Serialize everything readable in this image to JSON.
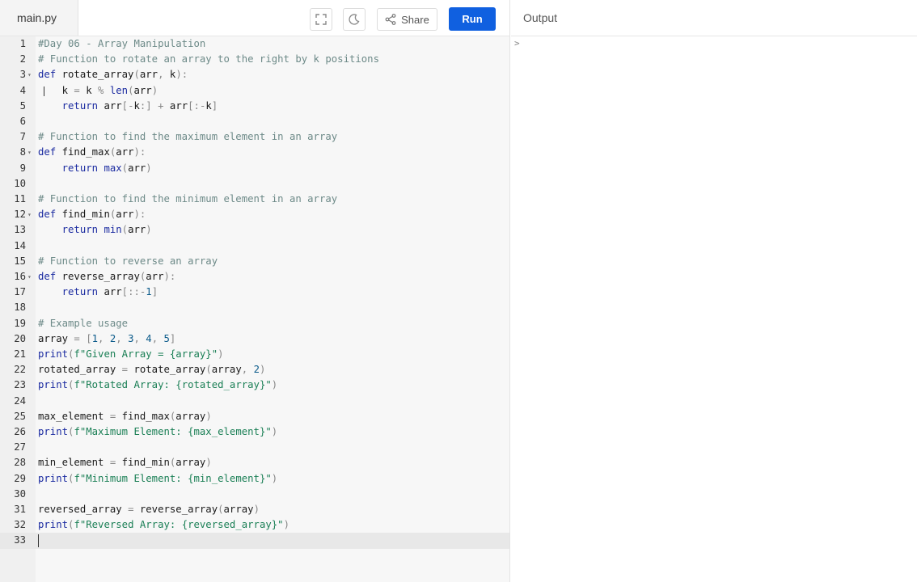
{
  "editor": {
    "file_tab": "main.py",
    "share_label": "Share",
    "run_label": "Run",
    "code_lines": [
      "#Day 06 - Array Manipulation",
      "# Function to rotate an array to the right by k positions",
      "def rotate_array(arr, k):",
      "    k = k % len(arr)",
      "    return arr[-k:] + arr[:-k]",
      "",
      "# Function to find the maximum element in an array",
      "def find_max(arr):",
      "    return max(arr)",
      "",
      "# Function to find the minimum element in an array",
      "def find_min(arr):",
      "    return min(arr)",
      "",
      "# Function to reverse an array",
      "def reverse_array(arr):",
      "    return arr[::-1]",
      "",
      "# Example usage",
      "array = [1, 2, 3, 4, 5]",
      "print(f\"Given Array = {array}\")",
      "rotated_array = rotate_array(array, 2)",
      "print(f\"Rotated Array: {rotated_array}\")",
      "",
      "max_element = find_max(array)",
      "print(f\"Maximum Element: {max_element}\")",
      "",
      "min_element = find_min(array)",
      "print(f\"Minimum Element: {min_element}\")",
      "",
      "reversed_array = reverse_array(array)",
      "print(f\"Reversed Array: {reversed_array}\")",
      ""
    ],
    "fold_lines": [
      3,
      8,
      12,
      16
    ],
    "active_line": 33
  },
  "output": {
    "title": "Output",
    "prompt": ">"
  },
  "colors": {
    "run_button": "#1060e0",
    "comment": "#6d8a88",
    "keyword": "#1a2aa0",
    "string": "#1a7f55"
  }
}
